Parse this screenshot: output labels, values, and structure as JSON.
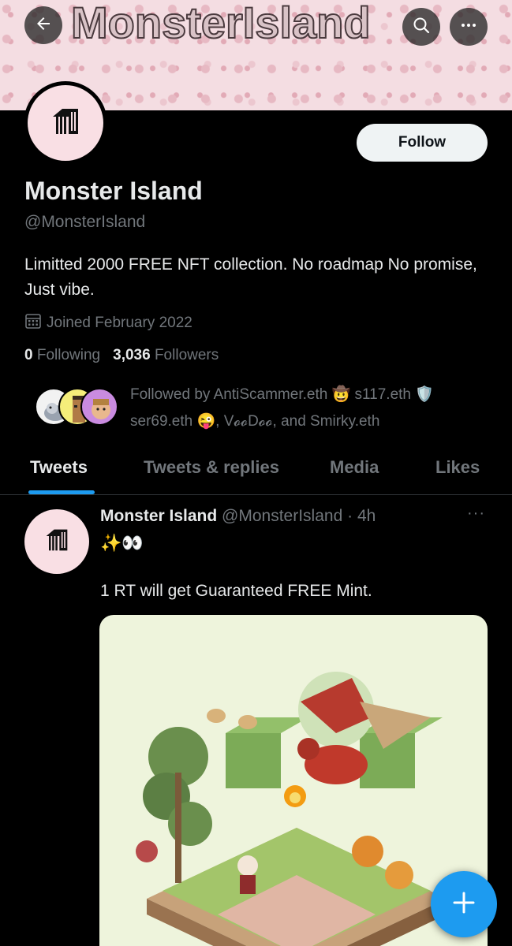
{
  "header": {
    "banner_title": "MonsterIsland"
  },
  "profile": {
    "follow_label": "Follow",
    "display_name": "Monster Island",
    "handle": "@MonsterIsland",
    "bio": "Limitted 2000 FREE NFT collection. No roadmap No promise, Just vibe.",
    "joined": "Joined February 2022",
    "following_count": "0",
    "following_label": "Following",
    "followers_count": "3,036",
    "followers_label": "Followers",
    "followed_by_line1": "Followed by AntiScammer.eth 🤠 s117.eth 🛡️",
    "followed_by_line2": "ser69.eth 😜, V𝓸𝓸D𝓸𝓸, and Smirky.eth"
  },
  "tabs": [
    {
      "label": "Tweets",
      "active": true
    },
    {
      "label": "Tweets & replies",
      "active": false
    },
    {
      "label": "Media",
      "active": false
    },
    {
      "label": "Likes",
      "active": false
    }
  ],
  "tweet": {
    "author_name": "Monster Island",
    "author_handle": "@MonsterIsland",
    "separator": "·",
    "time": "4h",
    "emoji_line": "✨👀",
    "text": "1 RT will get Guaranteed FREE Mint.",
    "more": "···"
  },
  "icons": {
    "back": "arrow-left-icon",
    "search": "search-icon",
    "more": "more-horizontal-icon",
    "calendar": "calendar-icon",
    "compose": "plus-icon"
  },
  "colors": {
    "accent": "#1d9bf0",
    "background": "#000000",
    "muted_text": "#71767b",
    "primary_text": "#e7e9ea"
  }
}
